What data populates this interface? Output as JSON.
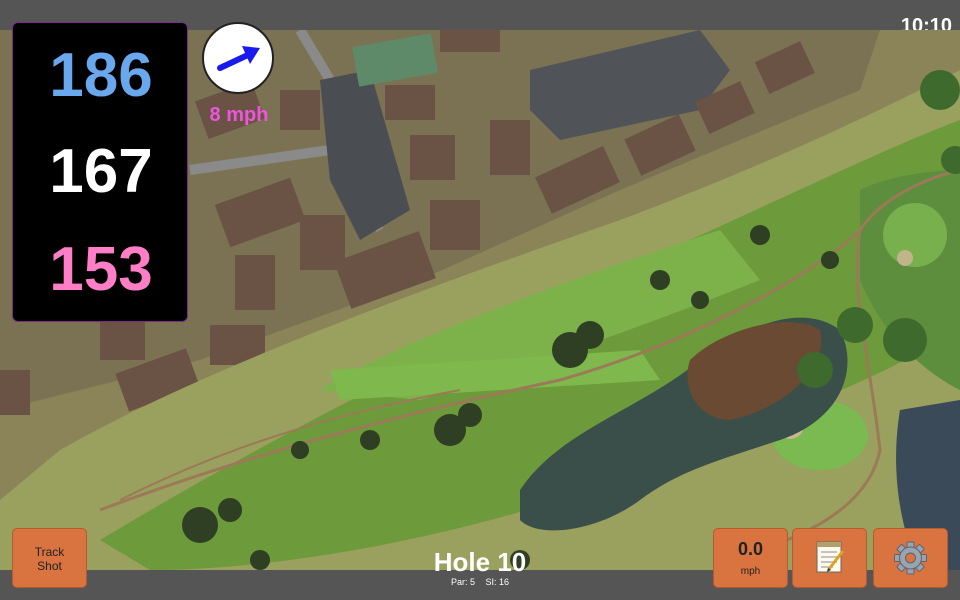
{
  "status": {
    "time": "10:10"
  },
  "distances": {
    "back": "186",
    "middle": "167",
    "front": "153"
  },
  "wind": {
    "speed": "8 mph",
    "direction_icon": "arrow-right-up-icon",
    "arrow_color": "#1a1aee"
  },
  "buttons": {
    "track_shot_line1": "Track",
    "track_shot_line2": "Shot",
    "speed_value": "0.0",
    "speed_unit": "mph",
    "notes_icon": "notepad-icon",
    "settings_icon": "gear-icon"
  },
  "hole": {
    "title": "Hole 10",
    "par": "Par: 5",
    "si": "SI: 16"
  },
  "colors": {
    "button": "#d9733f",
    "back_distance": "#6aa8ee",
    "front_distance": "#ff7ec6",
    "wind_speed": "#ee55dd"
  }
}
